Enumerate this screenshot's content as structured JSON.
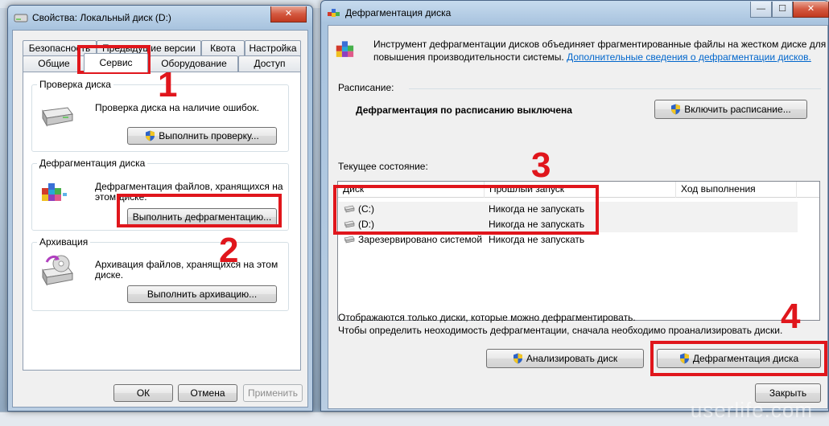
{
  "props_window": {
    "title": "Свойства: Локальный диск (D:)",
    "tabs_row1": [
      "Безопасность",
      "Предыдущие версии",
      "Квота",
      "Настройка"
    ],
    "tabs_row2": [
      "Общие",
      "Сервис",
      "Оборудование",
      "Доступ"
    ],
    "active_tab": "Сервис",
    "groups": {
      "check": {
        "title": "Проверка диска",
        "text": "Проверка диска на наличие ошибок.",
        "button": "Выполнить проверку..."
      },
      "defrag": {
        "title": "Дефрагментация диска",
        "text_line1": "Дефрагментация файлов, хранящихся на",
        "text_line2": "этом диске.",
        "button": "Выполнить дефрагментацию..."
      },
      "backup": {
        "title": "Архивация",
        "text_line1": "Архивация файлов, хранящихся на этом",
        "text_line2": "диске.",
        "button": "Выполнить архивацию..."
      }
    },
    "footer": {
      "ok": "ОК",
      "cancel": "Отмена",
      "apply": "Применить"
    }
  },
  "defrag_window": {
    "title": "Дефрагментация диска",
    "intro_line1": "Инструмент дефрагментации дисков объединяет фрагментированные файлы на жестком диске для",
    "intro_line2": "повышения производительности системы.",
    "intro_link": "Дополнительные сведения о дефрагментации дисков.",
    "schedule_label": "Расписание:",
    "schedule_status": "Дефрагментация по расписанию выключена",
    "schedule_button": "Включить расписание...",
    "current_label": "Текущее состояние:",
    "columns": [
      "Диск",
      "Прошлый запуск",
      "Ход выполнения"
    ],
    "rows": [
      {
        "disk": "(C:)",
        "last_run": "Никогда не запускать",
        "progress": ""
      },
      {
        "disk": "(D:)",
        "last_run": "Никогда не запускать",
        "progress": ""
      },
      {
        "disk": "Зарезервировано системой",
        "last_run": "Никогда не запускать",
        "progress": ""
      }
    ],
    "note_line1": "Отображаются только диски, которые можно дефрагментировать.",
    "note_line2": "Чтобы определить неоходимость  дефрагментации, сначала необходимо проанализировать диски.",
    "analyze_button": "Анализировать диск",
    "defrag_button": "Дефрагментация диска",
    "close_button": "Закрыть"
  },
  "annotations": [
    "1",
    "2",
    "3",
    "4"
  ],
  "watermark": "userlife.com",
  "colors": {
    "annotation_red": "#e0161c",
    "link_blue": "#0066cc",
    "window_frame": "#a9c4df"
  }
}
